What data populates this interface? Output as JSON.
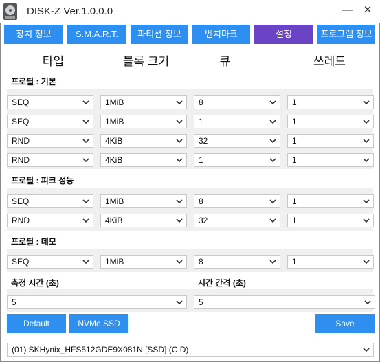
{
  "window": {
    "title": "DISK-Z Ver.1.0.0.0",
    "min": "—",
    "close": "✕"
  },
  "tabs": [
    "장치 정보",
    "S.M.A.R.T.",
    "파티션 정보",
    "벤치마크",
    "설정",
    "프로그램 정보"
  ],
  "columns": [
    "타입",
    "블록 크기",
    "큐",
    "쓰레드"
  ],
  "profiles": [
    {
      "label": "프로필 : 기본",
      "rows": [
        [
          "SEQ",
          "1MiB",
          "8",
          "1"
        ],
        [
          "SEQ",
          "1MiB",
          "1",
          "1"
        ],
        [
          "RND",
          "4KiB",
          "32",
          "1"
        ],
        [
          "RND",
          "4KiB",
          "1",
          "1"
        ]
      ]
    },
    {
      "label": "프로필 : 피크 성능",
      "rows": [
        [
          "SEQ",
          "1MiB",
          "8",
          "1"
        ],
        [
          "RND",
          "4KiB",
          "32",
          "1"
        ]
      ]
    },
    {
      "label": "프로필 : 데모",
      "rows": [
        [
          "SEQ",
          "1MiB",
          "8",
          "1"
        ]
      ]
    }
  ],
  "measure_time": {
    "label": "측정 시간 (초)",
    "value": "5"
  },
  "interval_time": {
    "label": "시간 간격 (초)",
    "value": "5"
  },
  "buttons": {
    "default": "Default",
    "nvme": "NVMe SSD",
    "save": "Save"
  },
  "drive": "(01) SKHynix_HFS512GDE9X081N [SSD] (C D)",
  "colors": {
    "accent": "#2e8ff0",
    "active_tab": "#6a44c4"
  }
}
